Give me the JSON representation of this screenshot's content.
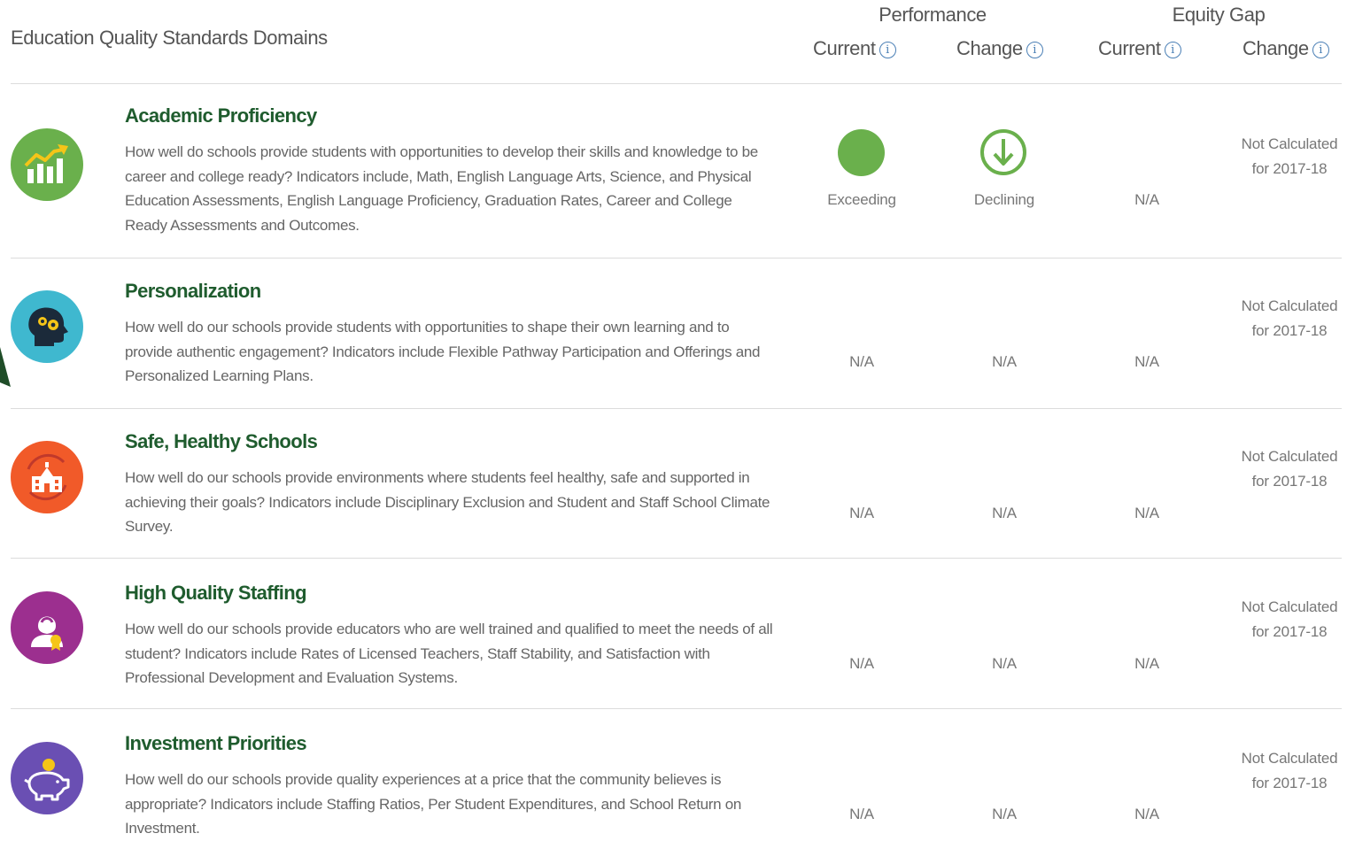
{
  "header": {
    "title": "Education Quality Standards Domains",
    "performance_label": "Performance",
    "equity_gap_label": "Equity Gap",
    "columns": {
      "perf_current": "Current",
      "perf_change": "Change",
      "equity_current": "Current",
      "equity_change": "Change"
    },
    "info_glyph": "i"
  },
  "colors": {
    "title_green": "#1f5c2e",
    "exceeding_green": "#6ab04c",
    "info_blue": "#4a7fb5",
    "academic_icon": "#6ab04c",
    "personalization_icon": "#3fb8cf",
    "safe_icon": "#f15a29",
    "staffing_icon": "#9c2f8f",
    "investment_icon": "#6a4fb3"
  },
  "rows": [
    {
      "icon": "growth-chart-icon",
      "title": "Academic Proficiency",
      "description": "How well do schools provide students with opportunities to develop their skills and knowledge to be career and college ready? Indicators include, Math, English Language Arts, Science, and Physical Education Assessments, English Language Proficiency, Graduation Rates, Career and College Ready Assessments and Outcomes.",
      "perf_current": "Exceeding",
      "perf_change": "Declining",
      "equity_current": "N/A",
      "equity_change": "Not Calculated for 2017-18"
    },
    {
      "icon": "head-gears-icon",
      "title": "Personalization",
      "description": "How well do our schools provide students with opportunities to shape their own learning and to provide authentic engagement? Indicators include Flexible Pathway Participation and Offerings and Personalized Learning Plans.",
      "perf_current": "N/A",
      "perf_change": "N/A",
      "equity_current": "N/A",
      "equity_change": "Not Calculated for 2017-18"
    },
    {
      "icon": "school-building-icon",
      "title": "Safe, Healthy Schools",
      "description": "How well do our schools provide environments where students feel healthy, safe and supported in achieving their goals? Indicators include Disciplinary Exclusion and Student and Staff School Climate Survey.",
      "perf_current": "N/A",
      "perf_change": "N/A",
      "equity_current": "N/A",
      "equity_change": "Not Calculated for 2017-18"
    },
    {
      "icon": "teacher-award-icon",
      "title": "High Quality Staffing",
      "description": "How well do our schools provide educators who are well trained and qualified to meet the needs of all student? Indicators include Rates of Licensed Teachers, Staff Stability, and Satisfaction with Professional Development and Evaluation Systems.",
      "perf_current": "N/A",
      "perf_change": "N/A",
      "equity_current": "N/A",
      "equity_change": "Not Calculated for 2017-18"
    },
    {
      "icon": "piggy-bank-icon",
      "title": "Investment Priorities",
      "description": "How well do our schools provide quality experiences at a price that the community believes is appropriate? Indicators include Staffing Ratios, Per Student Expenditures, and School Return on Investment.",
      "perf_current": "N/A",
      "perf_change": "N/A",
      "equity_current": "N/A",
      "equity_change": "Not Calculated for 2017-18"
    }
  ]
}
